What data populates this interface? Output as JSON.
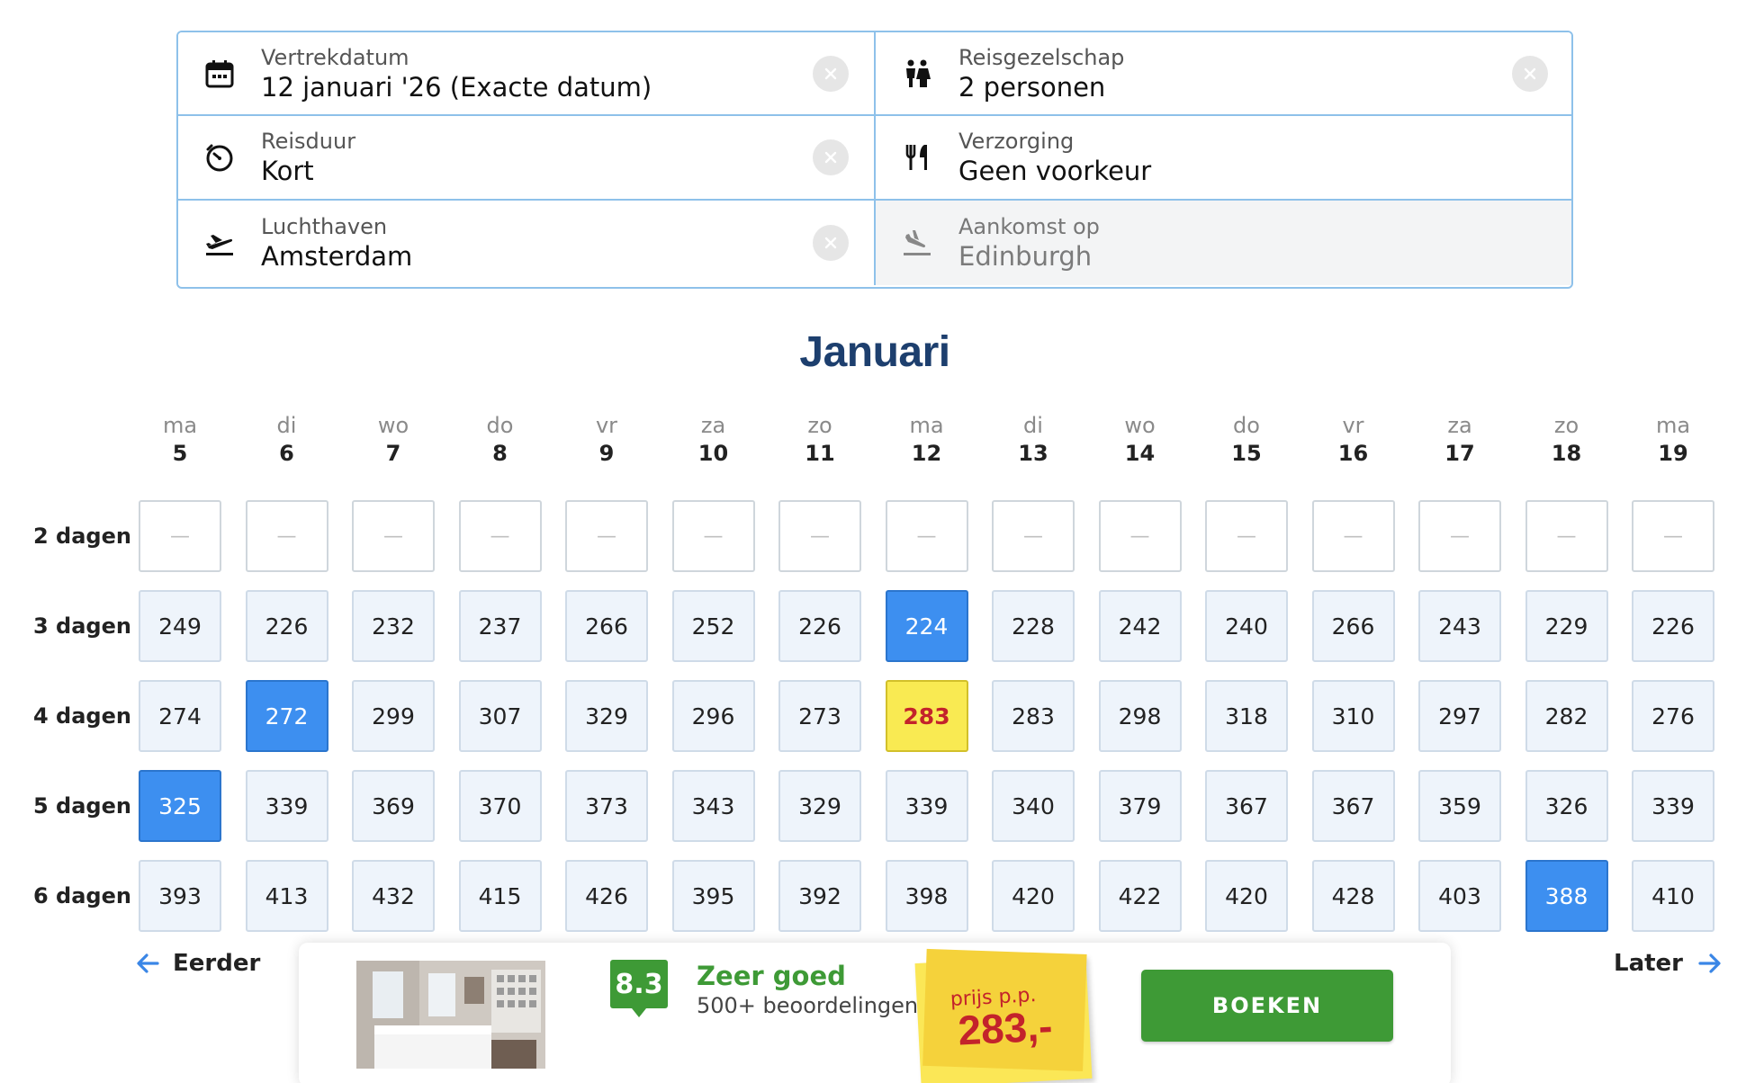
{
  "filters": [
    {
      "label": "Vertrekdatum",
      "value": "12 januari '26  (Exacte datum)",
      "icon": "calendar-icon",
      "clearable": true,
      "disabled": false
    },
    {
      "label": "Reisgezelschap",
      "value": "2 personen",
      "icon": "people-icon",
      "clearable": true,
      "disabled": false
    },
    {
      "label": "Reisduur",
      "value": "Kort",
      "icon": "timer-icon",
      "clearable": true,
      "disabled": false
    },
    {
      "label": "Verzorging",
      "value": "Geen voorkeur",
      "icon": "cutlery-icon",
      "clearable": false,
      "disabled": false
    },
    {
      "label": "Luchthaven",
      "value": "Amsterdam",
      "icon": "departure-plane-icon",
      "clearable": true,
      "disabled": false
    },
    {
      "label": "Aankomst op",
      "value": "Edinburgh",
      "icon": "arrival-plane-icon",
      "clearable": false,
      "disabled": true
    }
  ],
  "month": "Januari",
  "days": [
    {
      "name": "ma",
      "num": "5"
    },
    {
      "name": "di",
      "num": "6"
    },
    {
      "name": "wo",
      "num": "7"
    },
    {
      "name": "do",
      "num": "8"
    },
    {
      "name": "vr",
      "num": "9"
    },
    {
      "name": "za",
      "num": "10"
    },
    {
      "name": "zo",
      "num": "11"
    },
    {
      "name": "ma",
      "num": "12"
    },
    {
      "name": "di",
      "num": "13"
    },
    {
      "name": "wo",
      "num": "14"
    },
    {
      "name": "do",
      "num": "15"
    },
    {
      "name": "vr",
      "num": "16"
    },
    {
      "name": "za",
      "num": "17"
    },
    {
      "name": "zo",
      "num": "18"
    },
    {
      "name": "ma",
      "num": "19"
    }
  ],
  "rows": [
    {
      "label": "2 dagen",
      "prices": [
        "—",
        "—",
        "—",
        "—",
        "—",
        "—",
        "—",
        "—",
        "—",
        "—",
        "—",
        "—",
        "—",
        "—",
        "—"
      ]
    },
    {
      "label": "3 dagen",
      "prices": [
        "249",
        "226",
        "232",
        "237",
        "266",
        "252",
        "226",
        "224",
        "228",
        "242",
        "240",
        "266",
        "243",
        "229",
        "226"
      ]
    },
    {
      "label": "4 dagen",
      "prices": [
        "274",
        "272",
        "299",
        "307",
        "329",
        "296",
        "273",
        "283",
        "283",
        "298",
        "318",
        "310",
        "297",
        "282",
        "276"
      ]
    },
    {
      "label": "5 dagen",
      "prices": [
        "325",
        "339",
        "369",
        "370",
        "373",
        "343",
        "329",
        "339",
        "340",
        "379",
        "367",
        "367",
        "359",
        "326",
        "339"
      ]
    },
    {
      "label": "6 dagen",
      "prices": [
        "393",
        "413",
        "432",
        "415",
        "426",
        "395",
        "392",
        "398",
        "420",
        "422",
        "420",
        "428",
        "403",
        "388",
        "410"
      ]
    }
  ],
  "highlight": {
    "cheapest_cells": [
      [
        1,
        7
      ],
      [
        2,
        1
      ],
      [
        3,
        0
      ],
      [
        4,
        13
      ]
    ],
    "selected_cell": [
      2,
      7
    ],
    "cheapest_color": "#3d8ff0",
    "selected_color": "#f9ea52"
  },
  "nav": {
    "earlier": "Eerder",
    "later": "Later"
  },
  "booking": {
    "score": "8.3",
    "score_title": "Zeer goed",
    "reviews": "500+ beoordelingen",
    "price_label": "prijs p.p.",
    "price": "283,-",
    "button": "BOEKEN"
  },
  "colors": {
    "brand_green": "#3e9a36",
    "title_blue": "#1d3f6e",
    "accent_blue": "#3a86e6",
    "price_red": "#c3232b"
  }
}
